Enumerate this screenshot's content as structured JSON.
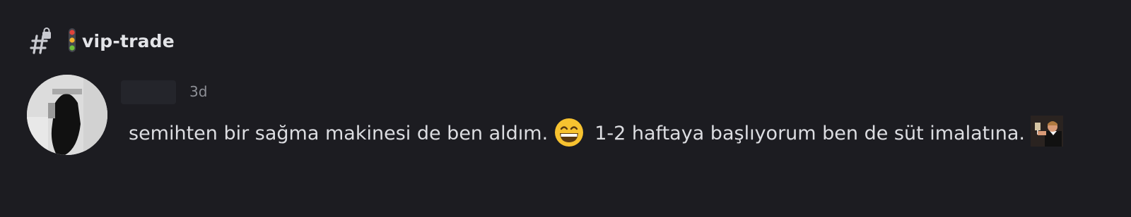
{
  "channel": {
    "name": "vip-trade",
    "icon": "locked-hash-icon",
    "prefix_icon": "traffic-light-icon"
  },
  "message": {
    "author_avatar": "avatar",
    "timestamp": "3d",
    "text_part1": "semihten bir sağma makinesi de ben aldım.",
    "text_part2": "1-2 haftaya başlıyorum ben de süt imalatına.",
    "emoji": "grinning-face-icon",
    "sticker": "toast-gif-icon"
  },
  "colors": {
    "background": "#1c1c21",
    "text": "#dcdde1",
    "muted": "#8e9097"
  }
}
